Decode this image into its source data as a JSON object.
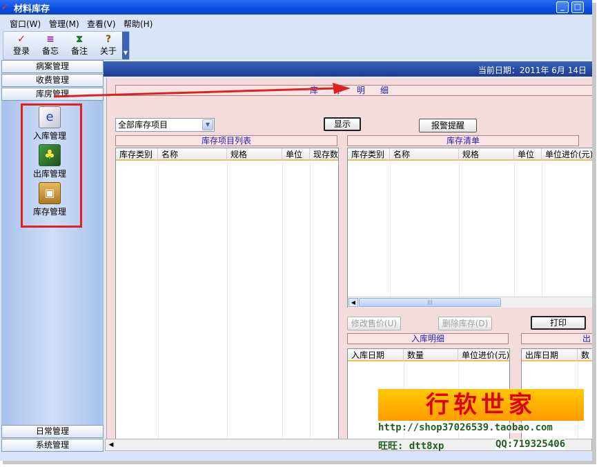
{
  "window": {
    "title": "材料库存",
    "minimize_label": "_",
    "close_label": "□"
  },
  "menu": [
    {
      "label": "窗口(W)"
    },
    {
      "label": "管理(M)"
    },
    {
      "label": "查看(V)"
    },
    {
      "label": "帮助(H)"
    }
  ],
  "toolbar": [
    {
      "label": "登录",
      "icon": "pen-icon",
      "glyph": "✓",
      "color": "#d01010"
    },
    {
      "label": "备忘",
      "icon": "memo-icon",
      "glyph": "≡",
      "color": "#8020a0"
    },
    {
      "label": "备注",
      "icon": "note-icon",
      "glyph": "⧗",
      "color": "#108020"
    },
    {
      "label": "关于",
      "icon": "help-icon",
      "glyph": "?",
      "color": "#806000"
    }
  ],
  "nav": {
    "top_sections": [
      {
        "label": "病案管理"
      },
      {
        "label": "收费管理"
      },
      {
        "label": "库房管理"
      }
    ],
    "items": [
      {
        "label": "入库管理",
        "icon": "stock-in-icon"
      },
      {
        "label": "出库管理",
        "icon": "stock-out-icon"
      },
      {
        "label": "库存管理",
        "icon": "inventory-icon"
      }
    ],
    "bottom_sections": [
      {
        "label": "日常管理"
      },
      {
        "label": "系统管理"
      }
    ]
  },
  "header": {
    "date": "当前日期：2011年 6月 14日"
  },
  "content": {
    "main_title": "库存明细",
    "filter_value": "全部库存项目",
    "show_button": "显示",
    "alarm_button": "报警提醒",
    "left_list_title": "库存项目列表",
    "left_columns": [
      "库存类别",
      "名称",
      "规格",
      "单位",
      "现存数"
    ],
    "right_list_title": "库存清单",
    "right_columns": [
      "库存类别",
      "名称",
      "规格",
      "单位",
      "单位进价(元)"
    ],
    "edit_price_button": "修改售价(U)",
    "delete_stock_button": "删除库存(D)",
    "print_button": "打印",
    "in_detail_title": "入库明细",
    "in_columns": [
      "入库日期",
      "数量",
      "单位进价(元)"
    ],
    "out_detail_title": "出",
    "out_columns": [
      "出库日期",
      "数"
    ]
  },
  "watermark": {
    "title": "行软世家",
    "url": "http://shop37026539.taobao.com",
    "wangwang": "旺旺: dtt8xp",
    "qq": "QQ:719325406"
  },
  "colors": {
    "titlebar": "#0a4be0",
    "annotation": "#e02020"
  }
}
